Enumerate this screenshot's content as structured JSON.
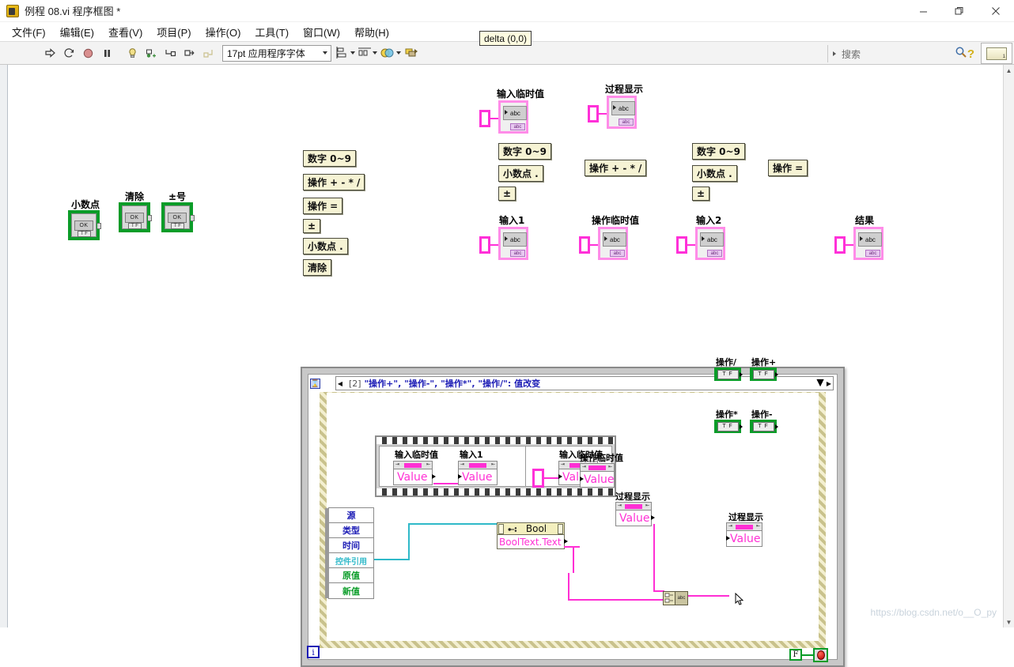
{
  "window": {
    "title": "例程 08.vi 程序框图 *",
    "app_icon": "labview-icon",
    "minimize": "−",
    "maximize": "❐",
    "close": "✕"
  },
  "menubar": {
    "items": [
      {
        "label": "文件(F)",
        "name": "menu-file"
      },
      {
        "label": "编辑(E)",
        "name": "menu-edit"
      },
      {
        "label": "查看(V)",
        "name": "menu-view"
      },
      {
        "label": "项目(P)",
        "name": "menu-project"
      },
      {
        "label": "操作(O)",
        "name": "menu-operate"
      },
      {
        "label": "工具(T)",
        "name": "menu-tools"
      },
      {
        "label": "窗口(W)",
        "name": "menu-window"
      },
      {
        "label": "帮助(H)",
        "name": "menu-help"
      }
    ]
  },
  "toolbar": {
    "font_selector": "17pt 应用程序字体",
    "tooltip": "delta (0,0)",
    "search_placeholder": "搜索",
    "help_symbol": "?",
    "context_help_badge": "1",
    "buttons": [
      {
        "name": "run-button",
        "glyph": "⇨"
      },
      {
        "name": "run-continuously-button",
        "glyph": "⟳"
      },
      {
        "name": "abort-execution-button",
        "glyph": "●"
      },
      {
        "name": "pause-button",
        "glyph": "❚❚"
      },
      {
        "name": "highlight-execution-button",
        "glyph": "💡"
      },
      {
        "name": "retain-wire-values-button",
        "glyph": "⊞"
      },
      {
        "name": "step-into-button",
        "glyph": "↳"
      },
      {
        "name": "step-over-button",
        "glyph": "⤼"
      },
      {
        "name": "step-out-button",
        "glyph": "↱"
      }
    ],
    "align_menus": [
      {
        "name": "align-objects-menu"
      },
      {
        "name": "distribute-objects-menu"
      },
      {
        "name": "resize-objects-menu"
      },
      {
        "name": "reorder-menu"
      }
    ]
  },
  "diagram": {
    "ok_terminals": [
      {
        "name": "terminal-decimal-point",
        "label": "小数点",
        "caption": "OK",
        "tf": "T F"
      },
      {
        "name": "terminal-clear",
        "label": "清除",
        "caption": "OK",
        "tf": "T F"
      },
      {
        "name": "terminal-plus-minus",
        "label": "±号",
        "caption": "OK",
        "tf": "T F"
      }
    ],
    "event_case_labels_left": [
      {
        "name": "case-label-digits",
        "label": "数字 0~9"
      },
      {
        "name": "case-label-operators",
        "label": "操作 +  -  *  /"
      },
      {
        "name": "case-label-equals",
        "label": "操作 ="
      },
      {
        "name": "case-label-signtoggle",
        "label": "±"
      },
      {
        "name": "case-label-decimal",
        "label": "小数点 ."
      },
      {
        "name": "case-label-clear",
        "label": "清除"
      }
    ],
    "event_case_labels_mid": [
      {
        "name": "case-label-digits-mid",
        "label": "数字 0~9"
      },
      {
        "name": "case-label-decimal-mid",
        "label": "小数点 ."
      },
      {
        "name": "case-label-signtoggle-mid",
        "label": "±"
      }
    ],
    "event_case_labels_mid2": [
      {
        "name": "case-label-operators-mid",
        "label": "操作 +  -  *  /"
      }
    ],
    "event_case_labels_right": [
      {
        "name": "case-label-digits-right",
        "label": "数字 0~9"
      },
      {
        "name": "case-label-decimal-right",
        "label": "小数点 ."
      },
      {
        "name": "case-label-signtoggle-right",
        "label": "±"
      }
    ],
    "event_case_labels_right2": [
      {
        "name": "case-label-equals-right",
        "label": "操作 ="
      }
    ],
    "string_refs": [
      {
        "name": "ref-input-temp-value",
        "label": "输入临时值",
        "type": "abc",
        "foot": "abc"
      },
      {
        "name": "ref-process-display-top",
        "label": "过程显示",
        "type": "abc",
        "foot": "abc"
      },
      {
        "name": "ref-input-1",
        "label": "输入1",
        "type": "abc",
        "foot": "abc"
      },
      {
        "name": "ref-operation-temp",
        "label": "操作临时值",
        "type": "abc",
        "foot": "abc"
      },
      {
        "name": "ref-input-2",
        "label": "输入2",
        "type": "abc",
        "foot": "abc"
      },
      {
        "name": "ref-result",
        "label": "结果",
        "type": "abc",
        "foot": "abc"
      }
    ]
  },
  "event_structure": {
    "case_index": "[2]",
    "case_label": "\"操作+\", \"操作-\", \"操作*\", \"操作/\": 值改变",
    "left_arrow": "◀",
    "right_arrow": "▶",
    "dropdown": "▼",
    "timeout_icon": "⌛",
    "sequence_frames": [
      {
        "name": "sequence-frame-1",
        "nodes": [
          {
            "name": "propnode-input-temp-value",
            "label": "输入临时值",
            "property": "Value"
          },
          {
            "name": "propnode-input-1",
            "label": "输入1",
            "property": "Value"
          }
        ]
      },
      {
        "name": "sequence-frame-2",
        "nodes": [
          {
            "name": "propnode-input-temp-value-2",
            "label": "输入临时值",
            "property": "Value"
          }
        ]
      }
    ],
    "event_data_node": {
      "name": "event-data-node",
      "items": [
        {
          "label": "源",
          "color": "#1b1bb5"
        },
        {
          "label": "类型",
          "color": "#1b1bb5"
        },
        {
          "label": "时间",
          "color": "#1b1bb5"
        },
        {
          "label": "控件引用",
          "color": "#2fb9c9"
        },
        {
          "label": "原值",
          "color": "#0a9c28"
        },
        {
          "label": "新值",
          "color": "#0a9c28"
        }
      ]
    },
    "bool_property_node": {
      "name": "bool-property-node",
      "title": "Bool",
      "property": "BoolText.Text"
    },
    "operation_temp_node": {
      "name": "propnode-operation-temp-value",
      "label": "操作临时值",
      "property": "Value"
    },
    "process_display_read": {
      "name": "propnode-process-display-read",
      "label": "过程显示",
      "property": "Value"
    },
    "process_display_write": {
      "name": "propnode-process-display-write",
      "label": "过程显示",
      "property": "Value"
    },
    "concat_function": {
      "name": "concatenate-strings-function",
      "glyph": "abc"
    },
    "bool_terminals": [
      {
        "name": "terminal-operation-divide",
        "label": "操作/",
        "tf": "T F"
      },
      {
        "name": "terminal-operation-plus",
        "label": "操作+",
        "tf": "T F"
      },
      {
        "name": "terminal-operation-multiply",
        "label": "操作*",
        "tf": "T F"
      },
      {
        "name": "terminal-operation-minus",
        "label": "操作-",
        "tf": "T F"
      }
    ],
    "loop": {
      "iteration_terminal": "i",
      "false_constant": "F",
      "stop_terminal": "stop-sign-icon"
    }
  },
  "watermark": "https://blog.csdn.net/o__O_py",
  "colors": {
    "wire_string": "#ff2fd4",
    "wire_refnum": "#2fb9c9",
    "boolean_green": "#0a9c28",
    "case_label_blue": "#1b1bb5",
    "structure_gray": "#c8c8c8"
  }
}
